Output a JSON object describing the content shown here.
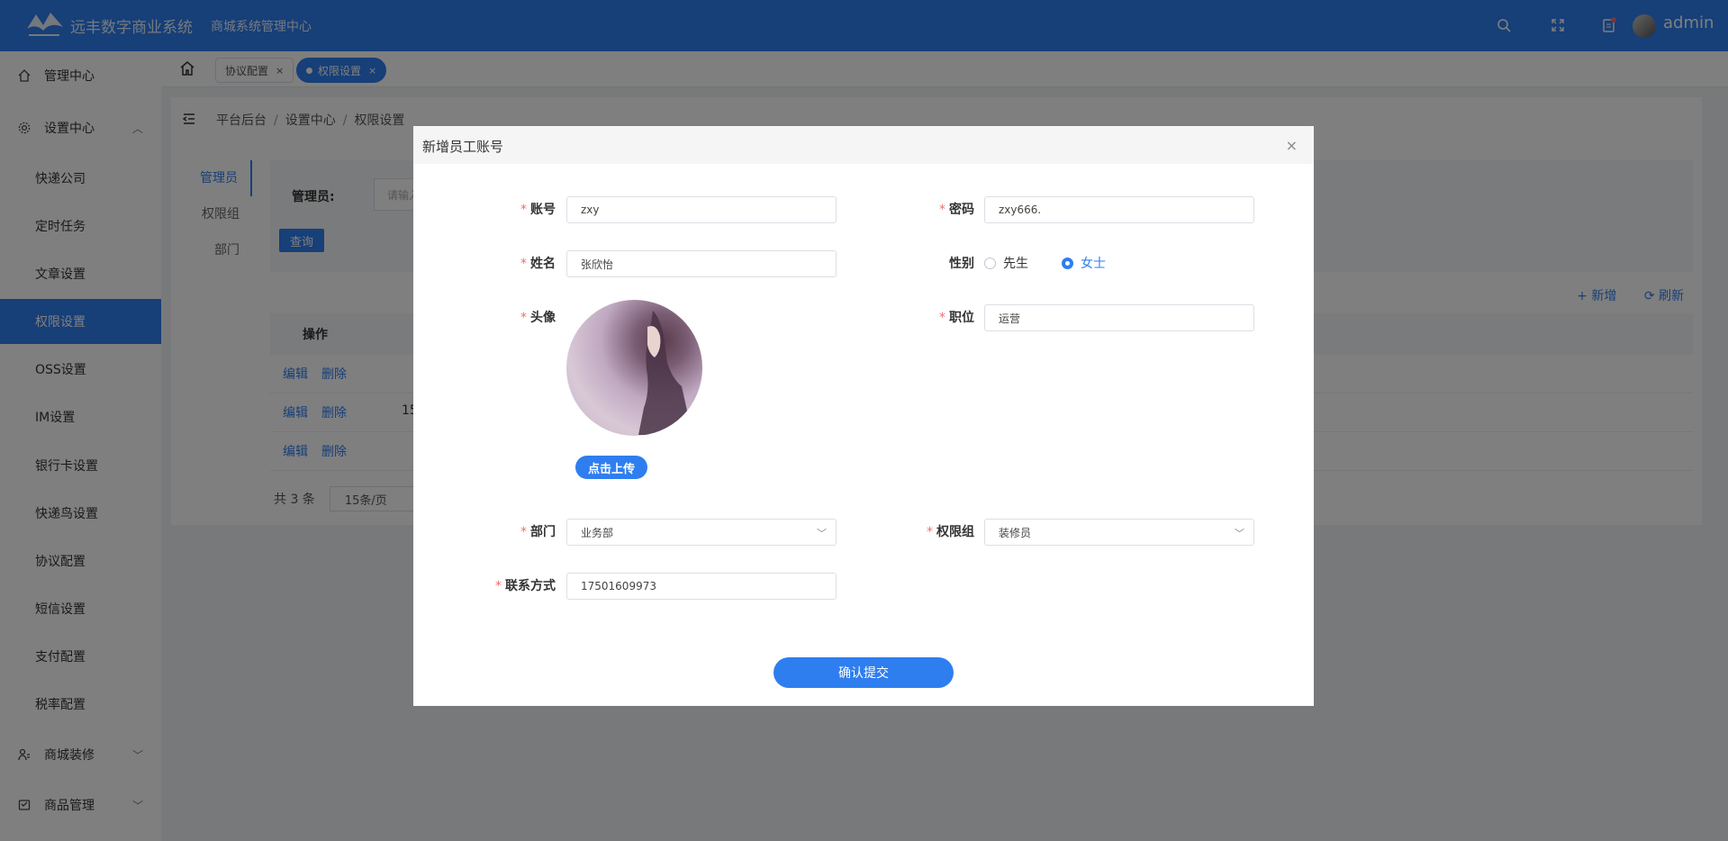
{
  "header": {
    "brand": "远丰数字商业系统",
    "subtitle": "商城系统管理中心",
    "username": "admin",
    "icons": [
      "search-icon",
      "fullscreen-icon",
      "notification-icon"
    ]
  },
  "sidebar": {
    "items": [
      {
        "label": "管理中心",
        "icon": "home-icon"
      },
      {
        "label": "设置中心",
        "icon": "gear-icon"
      }
    ],
    "sub_items": [
      "快递公司",
      "定时任务",
      "文章设置",
      "权限设置",
      "OSS设置",
      "IM设置",
      "银行卡设置",
      "快递鸟设置",
      "协议配置",
      "短信设置",
      "支付配置",
      "税率配置"
    ],
    "bottom_items": [
      {
        "label": "商城装修",
        "icon": "decorate-icon"
      },
      {
        "label": "商品管理",
        "icon": "goods-icon"
      }
    ]
  },
  "tabs": [
    {
      "label": "协议配置",
      "close": "×"
    },
    {
      "label": "权限设置",
      "close": "×"
    }
  ],
  "breadcrumb": {
    "root": "平台后台",
    "mid": "设置中心",
    "leaf": "权限设置",
    "sep": "/"
  },
  "inner_tabs": [
    "管理员",
    "权限组",
    "部门"
  ],
  "search": {
    "label": "管理员:",
    "placeholder": "请输入",
    "button": "查询"
  },
  "actions": {
    "add": "+ 新增",
    "refresh": "⟳ 刷新"
  },
  "table": {
    "header": "操作",
    "rows": [
      {
        "edit": "编辑",
        "delete": "删除",
        "extra": ""
      },
      {
        "edit": "编辑",
        "delete": "删除",
        "extra": "15"
      },
      {
        "edit": "编辑",
        "delete": "删除",
        "extra": ""
      }
    ]
  },
  "pager": {
    "total": "共 3 条",
    "page_size": "15条/页"
  },
  "dialog": {
    "title": "新增员工账号",
    "close": "×",
    "fields": {
      "account": {
        "label": "账号",
        "value": "zxy"
      },
      "password": {
        "label": "密码",
        "value": "zxy666."
      },
      "name": {
        "label": "姓名",
        "value": "张欣怡"
      },
      "gender": {
        "label": "性别",
        "options": [
          "先生",
          "女士"
        ],
        "selected": "女士"
      },
      "avatar": {
        "label": "头像",
        "upload": "点击上传"
      },
      "position": {
        "label": "职位",
        "value": "运营"
      },
      "department": {
        "label": "部门",
        "value": "业务部"
      },
      "role_group": {
        "label": "权限组",
        "value": "装修员"
      },
      "contact": {
        "label": "联系方式",
        "value": "17501609973"
      }
    },
    "required_mark": "*",
    "submit": "确认提交"
  },
  "colors": {
    "primary": "#2e7ef0",
    "required": "#f56c6c"
  }
}
